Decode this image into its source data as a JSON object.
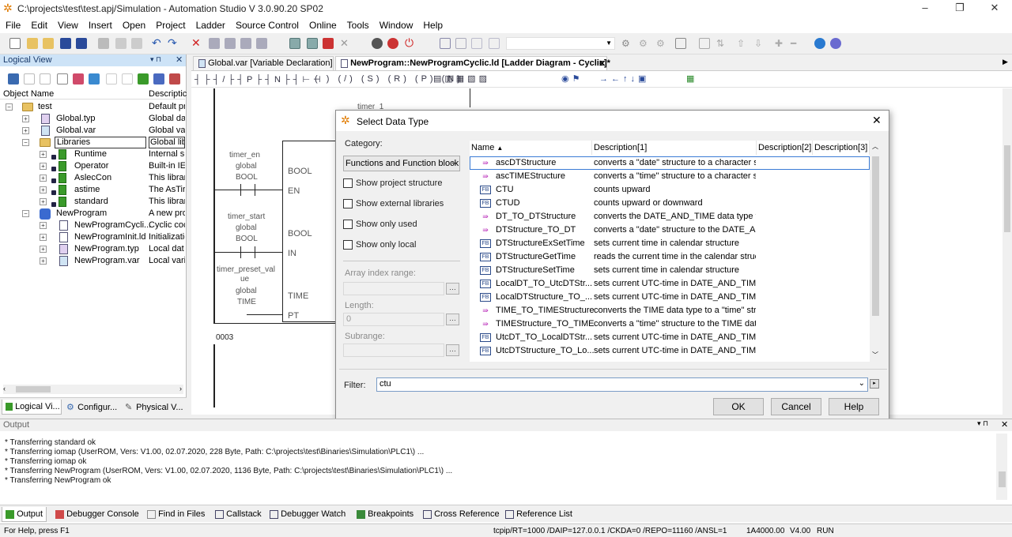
{
  "window": {
    "title": "C:\\projects\\test\\test.apj/Simulation - Automation Studio V 3.0.90.20 SP02"
  },
  "menu": [
    "File",
    "Edit",
    "View",
    "Insert",
    "Open",
    "Project",
    "Ladder",
    "Source Control",
    "Online",
    "Tools",
    "Window",
    "Help"
  ],
  "logical_view": {
    "title": "Logical View",
    "col_name": "Object Name",
    "col_desc": "Descriptic",
    "rows": [
      {
        "name": "test",
        "desc": "Default pr"
      },
      {
        "name": "Global.typ",
        "desc": "Global da"
      },
      {
        "name": "Global.var",
        "desc": "Global va"
      },
      {
        "name": "Libraries",
        "desc": "Global libr"
      },
      {
        "name": "Runtime",
        "desc": "Internal su"
      },
      {
        "name": "Operator",
        "desc": "Built-in IE"
      },
      {
        "name": "AslecCon",
        "desc": "This librar"
      },
      {
        "name": "astime",
        "desc": "The AsTir"
      },
      {
        "name": "standard",
        "desc": "This librar"
      },
      {
        "name": "NewProgram",
        "desc": "A new pro"
      },
      {
        "name": "NewProgramCycli...",
        "desc": "Cyclic coc"
      },
      {
        "name": "NewProgramInit.ld",
        "desc": "Initializatic"
      },
      {
        "name": "NewProgram.typ",
        "desc": "Local dat"
      },
      {
        "name": "NewProgram.var",
        "desc": "Local vari"
      }
    ],
    "tabs": [
      "Logical Vi...",
      "Configur...",
      "Physical V..."
    ]
  },
  "editor": {
    "tabs": [
      "Global.var [Variable Declaration]",
      "NewProgram::NewProgramCyclic.ld [Ladder Diagram - Cyclic]*"
    ],
    "ladder": {
      "timer_label": "timer_1",
      "en_var": "timer_en",
      "start_var": "timer_start",
      "preset_var1": "timer_preset_val",
      "preset_var2": "ue",
      "scope": "global",
      "bool": "BOOL",
      "time": "TIME",
      "pin_en": "EN",
      "pin_in": "IN",
      "pin_pt": "PT",
      "rung": "0003"
    }
  },
  "dialog": {
    "title": "Select Data Type",
    "category_label": "Category:",
    "category_value": "Functions and Function block",
    "checks": [
      "Show project structure",
      "Show external libraries",
      "Show only used",
      "Show only local"
    ],
    "array_label": "Array index range:",
    "length_label": "Length:",
    "length_value": "0",
    "subrange_label": "Subrange:",
    "columns": [
      "Name",
      "Description[1]",
      "Description[2]",
      "Description[3]"
    ],
    "rows": [
      {
        "name": "ascDTStructure",
        "desc": "converts a \"date\" structure to a character st...",
        "kind": "fn"
      },
      {
        "name": "ascTIMEStructure",
        "desc": "converts a \"time\" structure to a character st...",
        "kind": "fn"
      },
      {
        "name": "CTU",
        "desc": "counts upward",
        "kind": "fb"
      },
      {
        "name": "CTUD",
        "desc": "counts upward or downward",
        "kind": "fb"
      },
      {
        "name": "DT_TO_DTStructure",
        "desc": "converts the DATE_AND_TIME data type t...",
        "kind": "fn"
      },
      {
        "name": "DTStructure_TO_DT",
        "desc": "converts a \"date\" structure to the DATE_A...",
        "kind": "fn"
      },
      {
        "name": "DTStructureExSetTime",
        "desc": "sets current time in calendar structure",
        "kind": "fb"
      },
      {
        "name": "DTStructureGetTime",
        "desc": "reads the current time in the calendar struct...",
        "kind": "fb"
      },
      {
        "name": "DTStructureSetTime",
        "desc": "sets current time in calendar structure",
        "kind": "fb"
      },
      {
        "name": "LocalDT_TO_UtcDTStr...",
        "desc": "sets current UTC-time in DATE_AND_TIME...",
        "kind": "fb"
      },
      {
        "name": "LocalDTStructure_TO_...",
        "desc": "sets current UTC-time in DATE_AND_TIME...",
        "kind": "fb"
      },
      {
        "name": "TIME_TO_TIMEStructure",
        "desc": "converts the TIME data type to a \"time\" stru...",
        "kind": "fn"
      },
      {
        "name": "TIMEStructure_TO_TIME",
        "desc": "converts a \"time\" structure to the TIME dat...",
        "kind": "fn"
      },
      {
        "name": "UtcDT_TO_LocalDTStr...",
        "desc": "sets current UTC-time in DATE_AND_TIME...",
        "kind": "fb"
      },
      {
        "name": "UtcDTStructure_TO_Lo...",
        "desc": "sets current UTC-time in DATE_AND_TIME...",
        "kind": "fb"
      }
    ],
    "filter_label": "Filter:",
    "filter_value": "ctu",
    "ok": "OK",
    "cancel": "Cancel",
    "help": "Help"
  },
  "output": {
    "title": "Output",
    "lines": [
      "* Transferring standard ok",
      "* Transferring iomap (UserROM, Vers: V1.00, 02.07.2020, 228 Byte, Path: C:\\projects\\test\\Binaries\\Simulation\\PLC1\\) ...",
      "* Transferring iomap ok",
      "* Transferring NewProgram (UserROM, Vers: V1.00, 02.07.2020, 1136 Byte, Path: C:\\projects\\test\\Binaries\\Simulation\\PLC1\\) ...",
      "* Transferring NewProgram ok"
    ],
    "tabs": [
      "Output",
      "Debugger Console",
      "Find in Files",
      "Callstack",
      "Debugger Watch",
      "Breakpoints",
      "Cross Reference",
      "Reference List"
    ]
  },
  "status": {
    "help": "For Help, press F1",
    "conn": "tcpip/RT=1000 /DAIP=127.0.0.1 /CKDA=0 /REPO=11160 /ANSL=1",
    "cpu": "1A4000.00",
    "ver": "V4.00",
    "mode": "RUN"
  }
}
